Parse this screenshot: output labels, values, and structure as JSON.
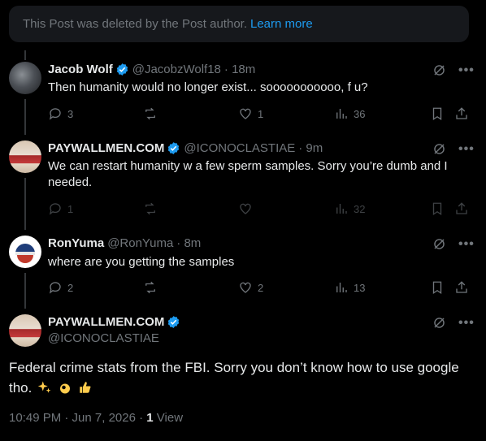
{
  "deleted_notice": {
    "text": "This Post was deleted by the Post author.",
    "link": "Learn more"
  },
  "replies": [
    {
      "name": "Jacob Wolf",
      "handle": "@JacobzWolf18",
      "time": "· 18m",
      "text": "Then humanity would no longer exist... sooooooooooo, f u?",
      "reply_count": "3",
      "repost_count": "",
      "like_count": "1",
      "view_count": "36"
    },
    {
      "name": "PAYWALLMEN.COM",
      "handle": "@ICONOCLASTIAE",
      "time": "· 9m",
      "text": "We can restart humanity w a few sperm samples. Sorry you’re dumb and I needed.",
      "reply_count": "1",
      "repost_count": "",
      "like_count": "",
      "view_count": "32"
    },
    {
      "name": "RonYuma",
      "handle": "@RonYuma",
      "time": "· 8m",
      "text": "where are you getting the samples",
      "reply_count": "2",
      "repost_count": "",
      "like_count": "2",
      "view_count": "13"
    }
  ],
  "main_post": {
    "name": "PAYWALLMEN.COM",
    "handle": "@ICONOCLASTIAE",
    "text": "Federal crime stats from the FBI. Sorry you don’t know how to use google tho.",
    "time": "10:49 PM · Jun 7, 2026 ·",
    "views": "1",
    "views_label": "View"
  },
  "icons": [
    "grok-icon",
    "more-icon",
    "reply-icon",
    "repost-icon",
    "like-icon",
    "views-icon",
    "bookmark-icon",
    "share-icon",
    "verified-icon"
  ],
  "colors": {
    "accent": "#1d9bf0",
    "muted": "#71767b",
    "background": "#000000"
  }
}
